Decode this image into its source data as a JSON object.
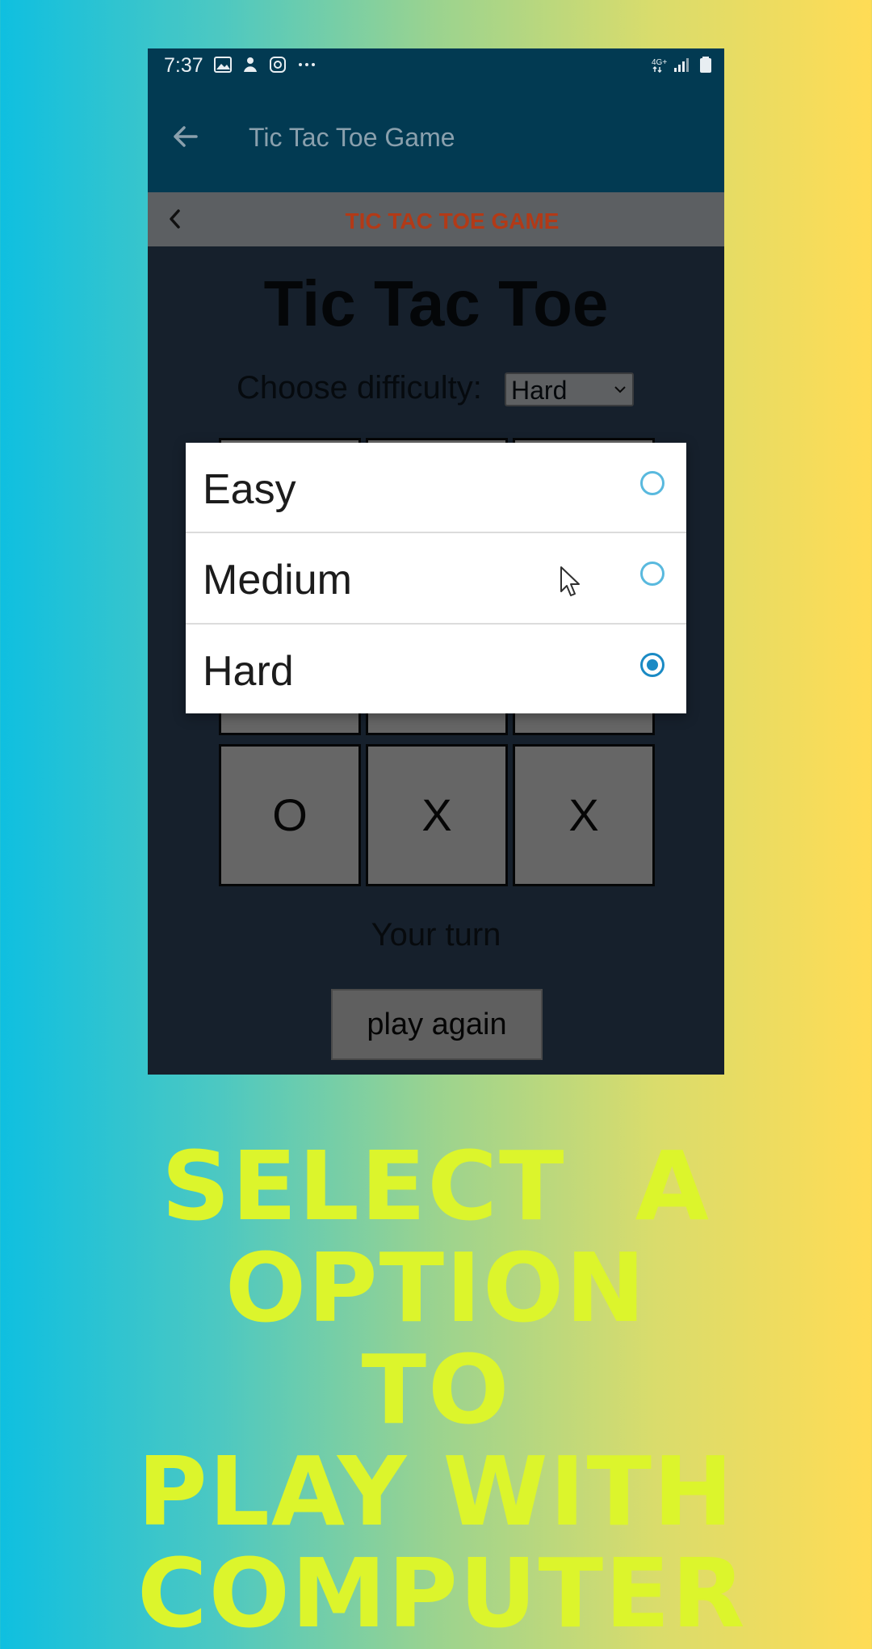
{
  "status_bar": {
    "time": "7:37",
    "left_icons": [
      "gallery-icon",
      "notification-icon",
      "instagram-icon",
      "more-dots-icon"
    ],
    "right_icons": [
      "network-4g-icon",
      "signal-icon",
      "battery-icon"
    ]
  },
  "app_bar": {
    "title": "Tic Tac Toe Game"
  },
  "sub_bar": {
    "title": "TIC TAC TOE GAME"
  },
  "game": {
    "title": "Tic Tac Toe",
    "difficulty_label": "Choose difficulty:",
    "selected_difficulty": "Hard",
    "bottom_row": [
      "O",
      "X",
      "X"
    ],
    "status": "Your turn",
    "play_again": "play again"
  },
  "dropdown": {
    "options": [
      {
        "label": "Easy",
        "selected": false
      },
      {
        "label": "Medium",
        "selected": false
      },
      {
        "label": "Hard",
        "selected": true
      }
    ]
  },
  "promo": {
    "line1": "SELECT  A",
    "line2": "OPTION TO",
    "line3": "PLAY WITH",
    "line4": "COMPUTER"
  },
  "colors": {
    "app_bar": "#023a52",
    "accent_title": "#b23a17",
    "radio": "#1a8ac4",
    "promo_text": "#dcf52c"
  }
}
